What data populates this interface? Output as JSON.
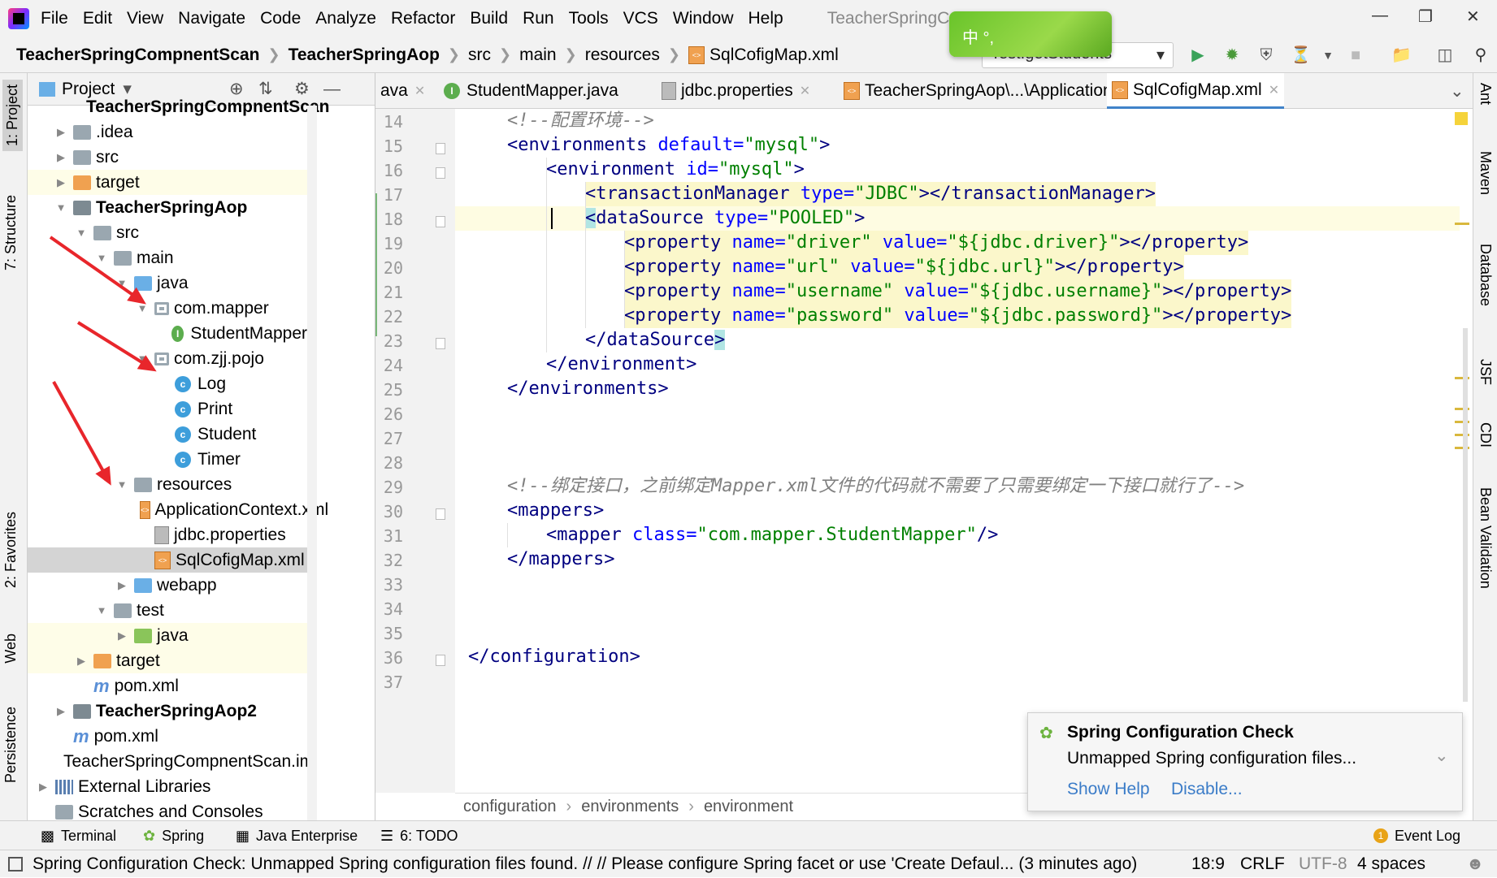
{
  "menu": [
    "File",
    "Edit",
    "View",
    "Navigate",
    "Code",
    "Analyze",
    "Refactor",
    "Build",
    "Run",
    "Tools",
    "VCS",
    "Window",
    "Help"
  ],
  "window_title": "TeacherSpringC",
  "ime_text": "中 °,",
  "breadcrumbs": [
    "TeacherSpringCompnentScan",
    "TeacherSpringAop",
    "src",
    "main",
    "resources",
    "SqlCofigMap.xml"
  ],
  "run_config": "Test.getStudents",
  "project_panel": {
    "title": "Project"
  },
  "left_tabs": [
    "1: Project",
    "7: Structure",
    "2: Favorites",
    "Web",
    "Persistence"
  ],
  "right_tabs": [
    "Ant",
    "Maven",
    "Database",
    "JSF",
    "CDI",
    "Bean Validation"
  ],
  "tree": [
    {
      "label": "TeacherSpringCompnentScan",
      "indent": 0
    },
    {
      "label": ".idea",
      "indent": 1
    },
    {
      "label": "src",
      "indent": 1
    },
    {
      "label": "target",
      "indent": 1
    },
    {
      "label": "TeacherSpringAop",
      "indent": 1
    },
    {
      "label": "src",
      "indent": 2
    },
    {
      "label": "main",
      "indent": 3
    },
    {
      "label": "java",
      "indent": 4
    },
    {
      "label": "com.mapper",
      "indent": 5
    },
    {
      "label": "StudentMapper",
      "indent": 6
    },
    {
      "label": "com.zjj.pojo",
      "indent": 5
    },
    {
      "label": "Log",
      "indent": 6
    },
    {
      "label": "Print",
      "indent": 6
    },
    {
      "label": "Student",
      "indent": 6
    },
    {
      "label": "Timer",
      "indent": 6
    },
    {
      "label": "resources",
      "indent": 4
    },
    {
      "label": "ApplicationContext.xml",
      "indent": 5
    },
    {
      "label": "jdbc.properties",
      "indent": 5
    },
    {
      "label": "SqlCofigMap.xml",
      "indent": 5
    },
    {
      "label": "webapp",
      "indent": 4
    },
    {
      "label": "test",
      "indent": 3
    },
    {
      "label": "java",
      "indent": 4
    },
    {
      "label": "target",
      "indent": 2
    },
    {
      "label": "pom.xml",
      "indent": 2
    },
    {
      "label": "TeacherSpringAop2",
      "indent": 1
    },
    {
      "label": "pom.xml",
      "indent": 1
    },
    {
      "label": "TeacherSpringCompnentScan.iml",
      "indent": 1
    },
    {
      "label": "External Libraries",
      "indent": 0
    },
    {
      "label": "Scratches and Consoles",
      "indent": 0
    }
  ],
  "tabs": [
    {
      "label": "ava"
    },
    {
      "label": "StudentMapper.java"
    },
    {
      "label": "jdbc.properties"
    },
    {
      "label": "TeacherSpringAop\\...\\ApplicationContext.xml"
    },
    {
      "label": "SqlCofigMap.xml"
    }
  ],
  "code": {
    "line_numbers": [
      "14",
      "15",
      "16",
      "17",
      "18",
      "19",
      "20",
      "21",
      "22",
      "23",
      "24",
      "25",
      "26",
      "27",
      "28",
      "29",
      "30",
      "31",
      "32",
      "33",
      "34",
      "35",
      "36",
      "37"
    ],
    "comment1": "<!--配置环境-->",
    "comment2": "<!--绑定接口，之前绑定Mapper.xml文件的代码就不需要了只需要绑定一下接口就行了-->",
    "env_default": "\"mysql\"",
    "env_id": "\"mysql\"",
    "tx_type": "\"JDBC\"",
    "ds_type": "\"POOLED\"",
    "props": [
      {
        "name": "\"driver\"",
        "value": "\"${jdbc.driver}\""
      },
      {
        "name": "\"url\"",
        "value": "\"${jdbc.url}\""
      },
      {
        "name": "\"username\"",
        "value": "\"${jdbc.username}\""
      },
      {
        "name": "\"password\"",
        "value": "\"${jdbc.password}\""
      }
    ],
    "mapper_class": "\"com.mapper.StudentMapper\""
  },
  "code_breadcrumbs": [
    "configuration",
    "environments",
    "environment"
  ],
  "notification": {
    "title": "Spring Configuration Check",
    "body": "Unmapped Spring configuration files...",
    "show_help": "Show Help",
    "disable": "Disable..."
  },
  "bottom_tools": [
    "Terminal",
    "Spring",
    "Java Enterprise",
    "6: TODO",
    "Event Log"
  ],
  "event_count": "1",
  "status": {
    "message": "Spring Configuration Check: Unmapped Spring configuration files found. // // Please configure Spring facet or use 'Create Defaul... (3 minutes ago)",
    "position": "18:9",
    "line_sep": "CRLF",
    "encoding": "UTF-8",
    "indent": "4 spaces"
  },
  "colors": {
    "tag": "#000080",
    "attr": "#0000ff",
    "value": "#008000",
    "comment": "#808080",
    "accent": "#4083c9"
  }
}
